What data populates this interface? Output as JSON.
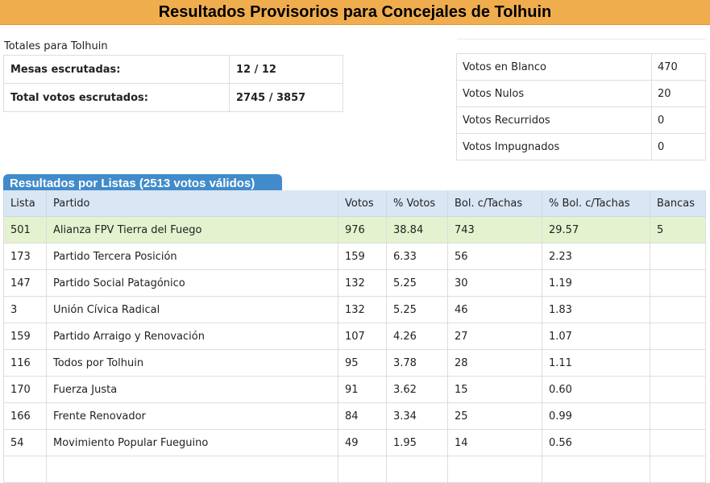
{
  "header": {
    "title": "Resultados Provisorios para Concejales de Tolhuin"
  },
  "totals": {
    "label": "Totales para Tolhuin",
    "rows": [
      {
        "key": "Mesas escrutadas:",
        "value": "12 / 12"
      },
      {
        "key": "Total votos escrutados:",
        "value": "2745 / 3857"
      }
    ]
  },
  "votes_summary": [
    {
      "key": "Votos en Blanco",
      "value": "470"
    },
    {
      "key": "Votos Nulos",
      "value": "20"
    },
    {
      "key": "Votos Recurridos",
      "value": "0"
    },
    {
      "key": "Votos Impugnados",
      "value": "0"
    }
  ],
  "results": {
    "section_title": "Resultados por Listas (2513 votos válidos)",
    "columns": [
      "Lista",
      "Partido",
      "Votos",
      "% Votos",
      "Bol. c/Tachas",
      "% Bol. c/Tachas",
      "Bancas"
    ],
    "rows": [
      [
        "501",
        "Alianza FPV Tierra del Fuego",
        "976",
        "38.84",
        "743",
        "29.57",
        "5"
      ],
      [
        "173",
        "Partido Tercera Posición",
        "159",
        "6.33",
        "56",
        "2.23",
        ""
      ],
      [
        "147",
        "Partido Social Patagónico",
        "132",
        "5.25",
        "30",
        "1.19",
        ""
      ],
      [
        "3",
        "Unión Cívica Radical",
        "132",
        "5.25",
        "46",
        "1.83",
        ""
      ],
      [
        "159",
        "Partido Arraigo y Renovación",
        "107",
        "4.26",
        "27",
        "1.07",
        ""
      ],
      [
        "116",
        "Todos por Tolhuin",
        "95",
        "3.78",
        "28",
        "1.11",
        ""
      ],
      [
        "170",
        "Fuerza Justa",
        "91",
        "3.62",
        "15",
        "0.60",
        ""
      ],
      [
        "166",
        "Frente Renovador",
        "84",
        "3.34",
        "25",
        "0.99",
        ""
      ],
      [
        "54",
        "Movimiento Popular Fueguino",
        "49",
        "1.95",
        "14",
        "0.56",
        ""
      ],
      [
        "",
        "",
        "",
        "",
        "",
        "",
        ""
      ]
    ]
  },
  "colors": {
    "header_bg": "#f0ad4e",
    "section_tab": "#428bca",
    "table_header_bg": "#d9e6f4",
    "winner_row_bg": "#e5f2cf"
  }
}
